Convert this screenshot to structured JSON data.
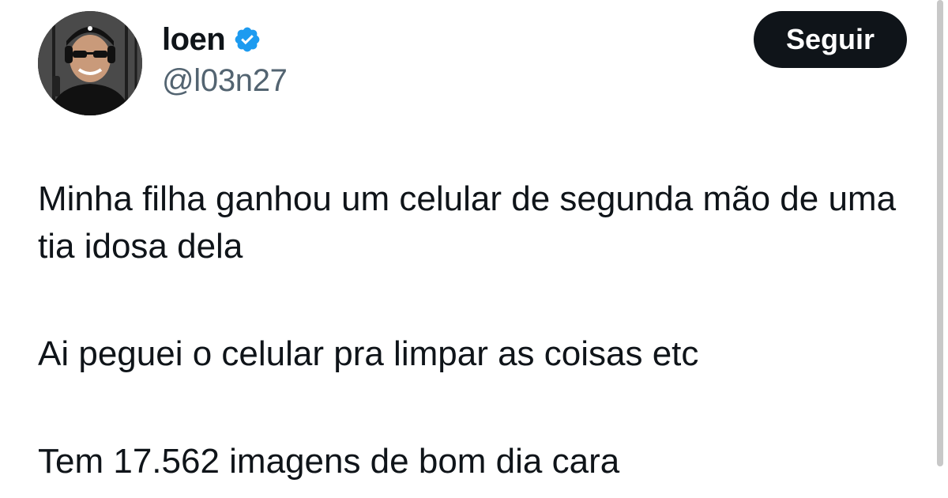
{
  "author": {
    "display_name": "loen",
    "handle": "@l03n27",
    "verified": true,
    "avatar_icon": "profile-photo"
  },
  "follow_button": {
    "label": "Seguir"
  },
  "tweet": {
    "paragraphs": [
      "Minha filha ganhou um celular de segunda mão de uma tia idosa dela",
      "Ai peguei o celular pra limpar as coisas etc",
      "Tem 17.562 imagens de bom dia cara"
    ]
  },
  "colors": {
    "verified_badge": "#1d9bf0",
    "button_bg": "#0f1419",
    "text_primary": "#0f1419",
    "text_secondary": "#536471"
  }
}
